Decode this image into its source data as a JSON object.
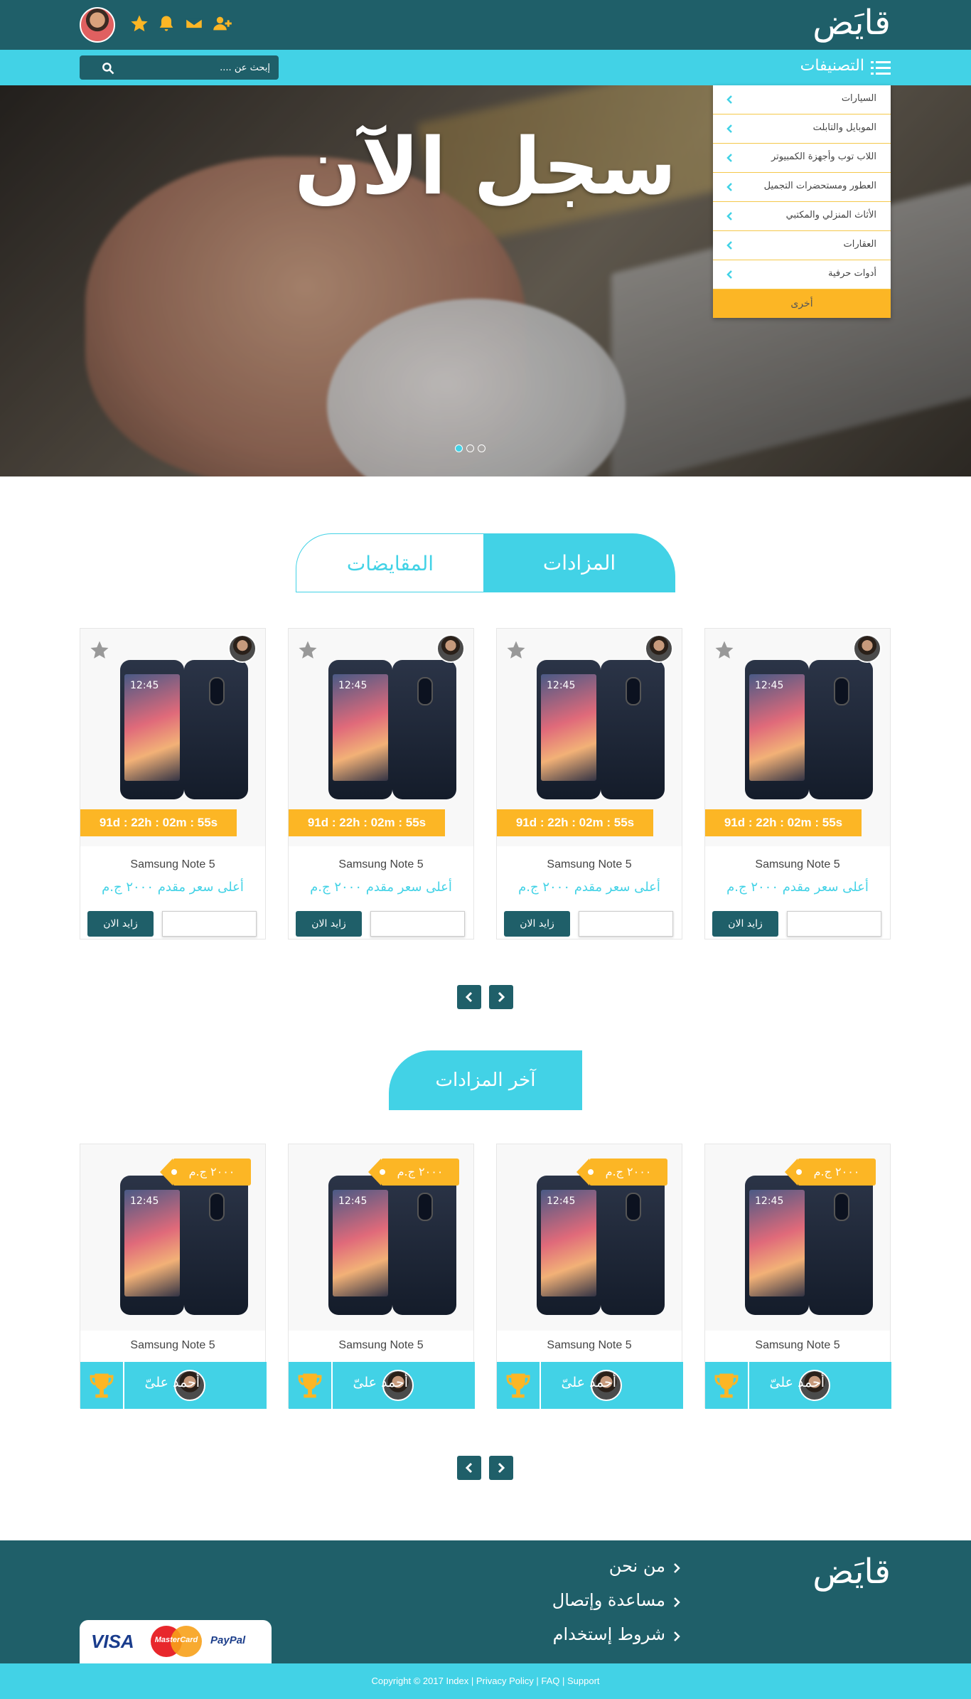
{
  "header": {
    "logo": "قايَض"
  },
  "category_bar": {
    "title": "التصنيفات",
    "search_placeholder": "إبحث عن ...."
  },
  "dropdown": {
    "items": [
      "السيارات",
      "الموبايل والتابلت",
      "اللاب توب وأجهزة الكمبيوتر",
      "العطور ومستحضرات التجميل",
      "الأثاث المنزلي والمكتبي",
      "العقارات",
      "أدوات حرفية"
    ],
    "other": "أخرى"
  },
  "hero": {
    "title": "سجل الآن",
    "slides": 3,
    "active_slide": 1
  },
  "tabs": {
    "active": "المزادات",
    "inactive": "المقايضات"
  },
  "auctions": [
    {
      "timer": "91d : 22h : 02m : 55s",
      "name": "Samsung Note 5",
      "price": "أعلى سعر مقدم ٢٠٠٠ ج.م",
      "button": "زايد الان",
      "clock": "12:45"
    },
    {
      "timer": "91d : 22h : 02m : 55s",
      "name": "Samsung Note 5",
      "price": "أعلى سعر مقدم ٢٠٠٠ ج.م",
      "button": "زايد الان",
      "clock": "12:45"
    },
    {
      "timer": "91d : 22h : 02m : 55s",
      "name": "Samsung Note 5",
      "price": "أعلى سعر مقدم ٢٠٠٠ ج.م",
      "button": "زايد الان",
      "clock": "12:45"
    },
    {
      "timer": "91d : 22h : 02m : 55s",
      "name": "Samsung Note 5",
      "price": "أعلى سعر مقدم ٢٠٠٠ ج.م",
      "button": "زايد الان",
      "clock": "12:45"
    }
  ],
  "latest": {
    "title": "آخر المزادات",
    "items": [
      {
        "price": "٢٠٠٠ ج.م",
        "name": "Samsung Note 5",
        "winner": "أحمد علىّ",
        "clock": "12:45"
      },
      {
        "price": "٢٠٠٠ ج.م",
        "name": "Samsung Note 5",
        "winner": "أحمد علىّ",
        "clock": "12:45"
      },
      {
        "price": "٢٠٠٠ ج.م",
        "name": "Samsung Note 5",
        "winner": "أحمد علىّ",
        "clock": "12:45"
      },
      {
        "price": "٢٠٠٠ ج.م",
        "name": "Samsung Note 5",
        "winner": "أحمد علىّ",
        "clock": "12:45"
      }
    ]
  },
  "footer": {
    "logo": "قايَض",
    "links": [
      "من نحن",
      "مساعدة وإتصال",
      "شروط إستخدام"
    ],
    "payments": [
      "VISA",
      "MasterCard",
      "PayPal"
    ],
    "copyright": "Copyright © 2017 Index | Privacy Policy | FAQ | Support"
  },
  "colors": {
    "dark_teal": "#1f5f69",
    "cyan": "#42d2e6",
    "orange": "#fcb625"
  }
}
